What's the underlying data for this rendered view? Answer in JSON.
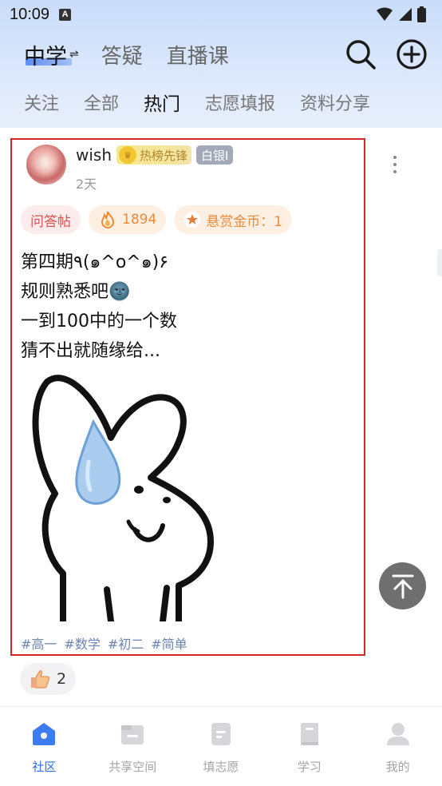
{
  "status_bar": {
    "time": "10:09",
    "notif_glyph": "A"
  },
  "header": {
    "stage": "中学",
    "tabs": [
      "答疑",
      "直播课"
    ],
    "sub_tabs": [
      "关注",
      "全部",
      "热门",
      "志愿填报",
      "资料分享"
    ],
    "active_sub_tab": "热门"
  },
  "post": {
    "username": "wish",
    "hot_badge": "热榜先锋",
    "level_badge": "白银I",
    "time": "2天",
    "type_tag": "问答帖",
    "heat": "1894",
    "reward": "悬赏金币：1",
    "text_lines": [
      "第四期٩(๑^o^๑)۶",
      "规则熟悉吧🌚",
      "一到100中的一个数",
      "猜不出就随缘给..."
    ],
    "hashtags": [
      "#高一",
      "#数学",
      "#初二",
      "#简单"
    ],
    "likes": "2"
  },
  "bottom_nav": [
    {
      "label": "社区",
      "icon": "community-icon",
      "active": true
    },
    {
      "label": "共享空间",
      "icon": "shared-space-icon",
      "active": false
    },
    {
      "label": "填志愿",
      "icon": "application-form-icon",
      "active": false
    },
    {
      "label": "学习",
      "icon": "book-icon",
      "active": false
    },
    {
      "label": "我的",
      "icon": "profile-icon",
      "active": false
    }
  ],
  "colors": {
    "accent": "#2f6fe8",
    "highlight_border": "#d0282c",
    "qa_tag": "#e0504f",
    "heat": "#e98a3b",
    "hashtag": "#6b84b0"
  }
}
